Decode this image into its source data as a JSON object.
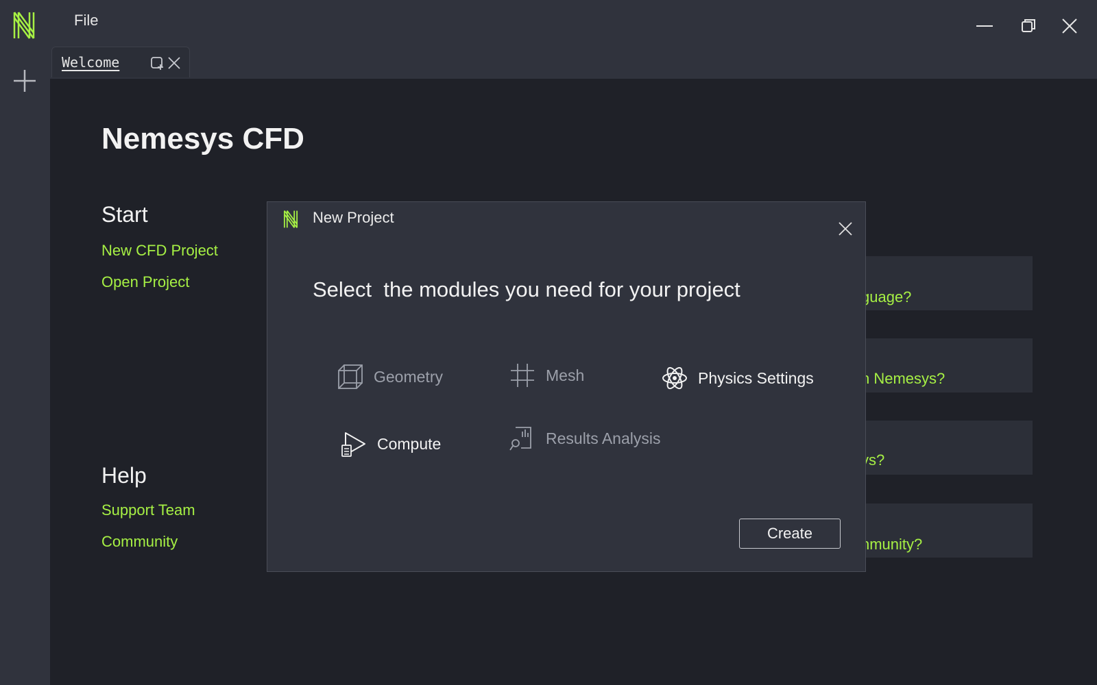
{
  "window": {
    "menu": [
      "File"
    ]
  },
  "tabs": [
    {
      "label": "Welcome"
    }
  ],
  "welcome": {
    "title": "Nemesys CFD",
    "start": {
      "heading": "Start",
      "links": [
        "New CFD Project",
        "Open Project"
      ]
    },
    "help": {
      "heading": "Help",
      "links": [
        "Support Team",
        "Community"
      ]
    },
    "cards": [
      "guage?",
      "n Nemesys?",
      "ys?",
      "nmunity?"
    ]
  },
  "dialog": {
    "title": "New Project",
    "heading": "Select  the modules you need for your project",
    "modules": [
      {
        "label": "Geometry",
        "icon": "cube-icon",
        "selected": false
      },
      {
        "label": "Mesh",
        "icon": "grid-icon",
        "selected": false
      },
      {
        "label": "Physics Settings",
        "icon": "atom-icon",
        "selected": true
      },
      {
        "label": "Compute",
        "icon": "compute-icon",
        "selected": true
      },
      {
        "label": "Results Analysis",
        "icon": "results-analysis-icon",
        "selected": false
      }
    ],
    "create_label": "Create"
  },
  "colors": {
    "accent": "#a6f044",
    "background": "#1f2128",
    "panel": "#30333d"
  }
}
